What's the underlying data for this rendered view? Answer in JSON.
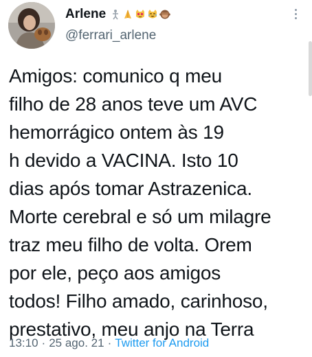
{
  "author": {
    "display_name": "Arlene",
    "handle": "@ferrari_arlene",
    "name_emojis": [
      "person-icon",
      "praying-hands-icon",
      "cat-heart-eyes-icon",
      "cat-laughing-icon",
      "see-no-evil-monkey-icon"
    ]
  },
  "tweet": {
    "lines": [
      "Amigos: comunico q meu",
      "filho de 28 anos teve um AVC",
      "hemorrágico ontem às 19",
      "h devido a VACINA. Isto 10",
      "dias após tomar Astrazenica.",
      "Morte cerebral e só um milagre",
      "traz meu filho de volta. Orem",
      "por ele, peço aos amigos",
      "todos! Filho amado, carinhoso,",
      "prestativo, meu anjo na Terra"
    ]
  },
  "meta": {
    "time": "13:10",
    "separator": "·",
    "date": "25 ago. 21",
    "source": "Twitter for Android"
  },
  "colors": {
    "text": "#0f1419",
    "secondary": "#536471",
    "link": "#1d9bf0"
  }
}
